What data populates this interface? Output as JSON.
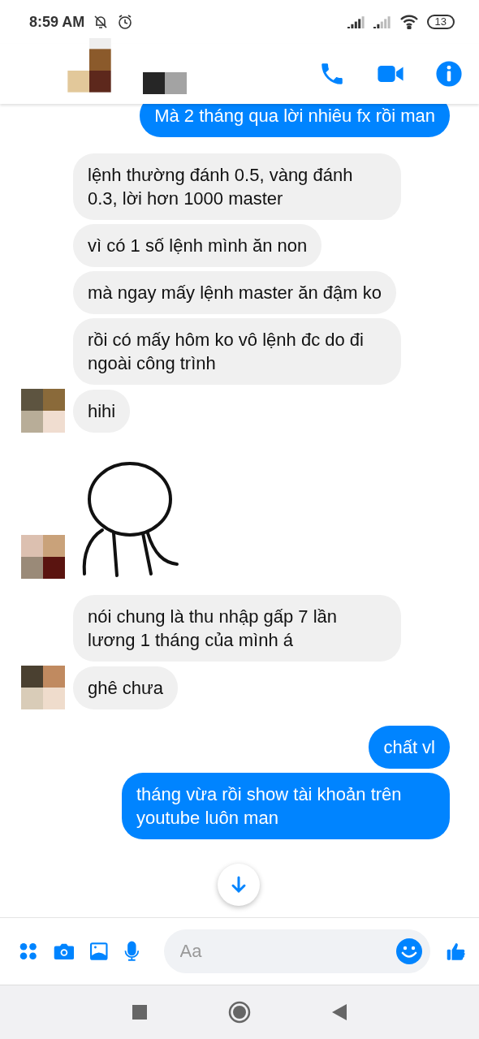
{
  "status_bar": {
    "time": "8:59 AM",
    "battery": "13"
  },
  "messages": [
    {
      "outgoing": true,
      "kind": "text",
      "text": "Mà 2 tháng qua lời nhiêu fx rồi man"
    },
    {
      "outgoing": false,
      "kind": "text",
      "text": "lệnh thường đánh 0.5, vàng đánh 0.3, lời hơn 1000 master",
      "avatar": false
    },
    {
      "outgoing": false,
      "kind": "text",
      "text": "vì có 1 số lệnh mình ăn non",
      "avatar": false
    },
    {
      "outgoing": false,
      "kind": "text",
      "text": "mà ngay mấy lệnh master ăn đậm ko",
      "avatar": false
    },
    {
      "outgoing": false,
      "kind": "text",
      "text": "rồi có mấy hôm ko vô lệnh đc do đi ngoài công trình",
      "avatar": false
    },
    {
      "outgoing": false,
      "kind": "text",
      "text": "hihi",
      "avatar": true
    },
    {
      "outgoing": false,
      "kind": "sticker",
      "avatar": true
    },
    {
      "outgoing": false,
      "kind": "text",
      "text": "nói chung là thu nhập gấp 7 lần lương 1 tháng của mình á",
      "avatar": false
    },
    {
      "outgoing": false,
      "kind": "text",
      "text": "ghê chưa",
      "avatar": true
    },
    {
      "outgoing": true,
      "kind": "text",
      "text": "chất vl"
    },
    {
      "outgoing": true,
      "kind": "text",
      "text": "tháng vừa rồi show tài khoản trên youtube luôn man"
    }
  ],
  "composer": {
    "placeholder": "Aa"
  }
}
